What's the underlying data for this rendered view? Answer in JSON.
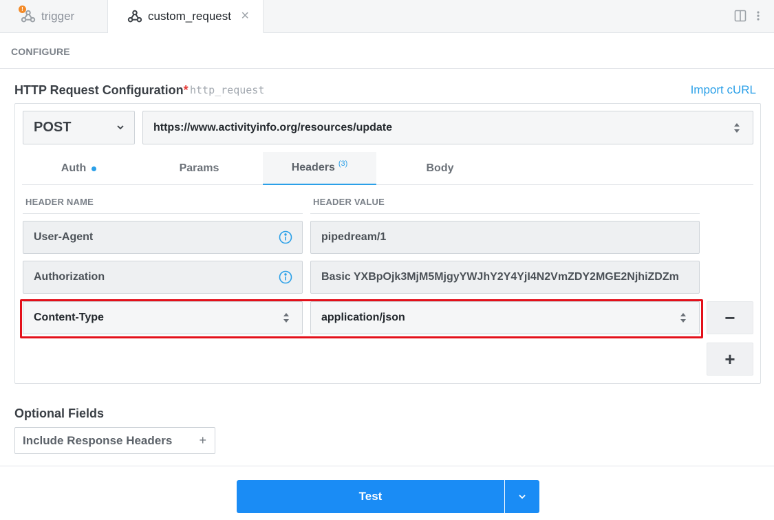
{
  "tabs": [
    {
      "label": "trigger",
      "badge": "!"
    },
    {
      "label": "custom_request",
      "close": "×"
    }
  ],
  "configure": {
    "label": "CONFIGURE"
  },
  "section": {
    "title": "HTTP Request Configuration",
    "required_mark": "*",
    "key": "http_request",
    "import_label": "Import cURL"
  },
  "request": {
    "method": "POST",
    "url": "https://www.activityinfo.org/resources/update"
  },
  "subtabs": {
    "auth": "Auth",
    "params": "Params",
    "headers": "Headers",
    "headers_count": "(3)",
    "body": "Body"
  },
  "headers_table": {
    "name_col": "HEADER NAME",
    "value_col": "HEADER VALUE",
    "rows": [
      {
        "name": "User-Agent",
        "value": "pipedream/1"
      },
      {
        "name": "Authorization",
        "value": "Basic YXBpOjk3MjM5MjgyYWJhY2Y4YjI4N2VmZDY2MGE2NjhiZDZm"
      },
      {
        "name": "Content-Type",
        "value": "application/json"
      }
    ],
    "remove_label": "−",
    "add_label": "+"
  },
  "optional": {
    "title": "Optional Fields",
    "include_headers": "Include Response Headers",
    "plus": "+"
  },
  "footer": {
    "test_label": "Test"
  },
  "colors": {
    "accent": "#1a8cf5",
    "link": "#2ba0e8",
    "highlight": "#e3101a",
    "badge": "#f38b2a"
  }
}
